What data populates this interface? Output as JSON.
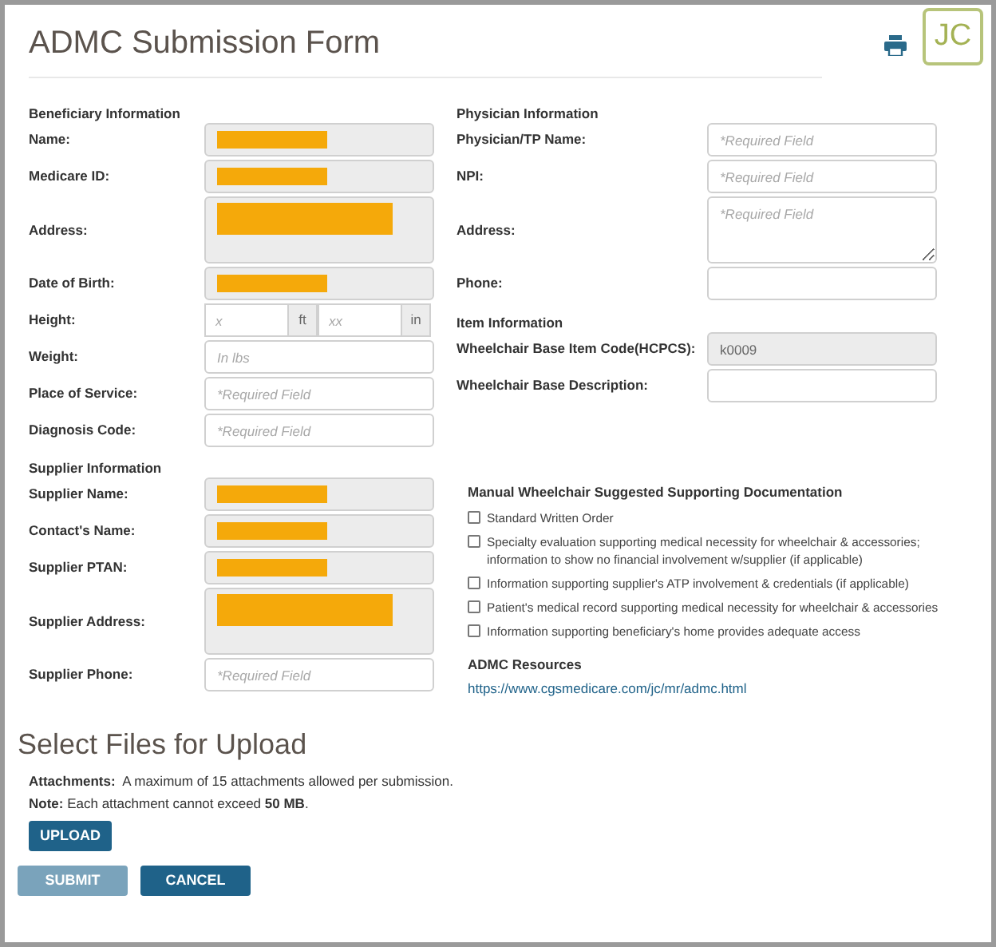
{
  "title": "ADMC Submission Form",
  "avatar": "JC",
  "beneficiary": {
    "heading": "Beneficiary Information",
    "fields": [
      {
        "label": "Name:",
        "kind": "input",
        "disabled": true,
        "redacted": true
      },
      {
        "label": "Medicare ID:",
        "kind": "input",
        "disabled": true,
        "redacted": true
      },
      {
        "label": "Address:",
        "kind": "textarea",
        "disabled": true,
        "redacted": true
      },
      {
        "label": "Date of Birth:",
        "kind": "input",
        "disabled": true,
        "redacted": true
      },
      {
        "label": "Height:",
        "kind": "height",
        "feet_placeholder": "x",
        "feet_unit": "ft",
        "inches_placeholder": "xx",
        "inches_unit": "in"
      },
      {
        "label": "Weight:",
        "kind": "input",
        "disabled": false,
        "placeholder": "In lbs"
      },
      {
        "label": "Place of Service:",
        "kind": "input",
        "disabled": false,
        "placeholder": "*Required Field"
      },
      {
        "label": "Diagnosis Code:",
        "kind": "input",
        "disabled": false,
        "placeholder": "*Required Field"
      }
    ]
  },
  "physician": {
    "heading": "Physician Information",
    "fields": [
      {
        "label": "Physician/TP Name:",
        "kind": "input",
        "disabled": false,
        "placeholder": "*Required Field"
      },
      {
        "label": "NPI:",
        "kind": "input",
        "disabled": false,
        "placeholder": "*Required Field"
      },
      {
        "label": "Address:",
        "kind": "textarea",
        "disabled": false,
        "placeholder": "*Required Field"
      },
      {
        "label": "Phone:",
        "kind": "input",
        "disabled": false
      }
    ]
  },
  "item": {
    "heading": "Item Information",
    "fields": [
      {
        "label": "Wheelchair Base Item Code(HCPCS):",
        "kind": "input",
        "disabled": true,
        "value": "k0009"
      },
      {
        "label": "Wheelchair Base Description:",
        "kind": "input",
        "disabled": false
      }
    ]
  },
  "supplier": {
    "heading": "Supplier Information",
    "fields": [
      {
        "label": "Supplier Name:",
        "kind": "input",
        "disabled": true,
        "redacted": true
      },
      {
        "label": "Contact's Name:",
        "kind": "input",
        "disabled": true,
        "redacted": true
      },
      {
        "label": "Supplier PTAN:",
        "kind": "input",
        "disabled": true,
        "redacted": true
      },
      {
        "label": "Supplier Address:",
        "kind": "textarea",
        "disabled": true,
        "redacted": true
      },
      {
        "label": "Supplier Phone:",
        "kind": "input",
        "disabled": false,
        "placeholder": "*Required Field"
      }
    ]
  },
  "documentation": {
    "heading": "Manual Wheelchair Suggested Supporting Documentation",
    "items": [
      {
        "label": "Standard Written Order",
        "checked": false
      },
      {
        "label": "Specialty evaluation supporting medical necessity for wheelchair & accessories; information to show no financial involvement w/supplier (if applicable)",
        "checked": false
      },
      {
        "label": "Information supporting supplier's ATP involvement & credentials (if applicable)",
        "checked": false
      },
      {
        "label": "Patient's medical record supporting medical necessity for wheelchair & accessories",
        "checked": false
      },
      {
        "label": "Information supporting beneficiary's home provides adequate access",
        "checked": false
      }
    ]
  },
  "resources": {
    "heading": "ADMC Resources",
    "link": "https://www.cgsmedicare.com/jc/mr/admc.html"
  },
  "upload": {
    "title": "Select Files for Upload",
    "notes": [
      "**Attachments:**  A maximum of 15 attachments allowed per submission.",
      "**Note:** Each attachment cannot exceed **50 MB**."
    ],
    "button": "UPLOAD"
  },
  "buttons": [
    {
      "label": "SUBMIT",
      "disabled": true
    },
    {
      "label": "CANCEL",
      "disabled": false
    }
  ]
}
